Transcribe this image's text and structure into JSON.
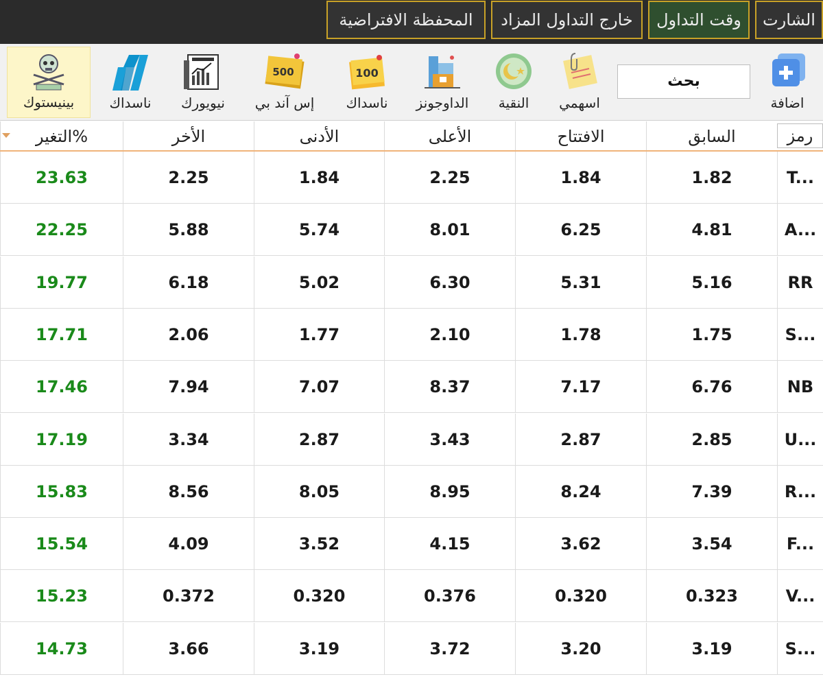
{
  "tabs": [
    {
      "label": "الشارت",
      "active": false
    },
    {
      "label": "وقت التداول",
      "active": true
    },
    {
      "label": "خارج التداول المزاد",
      "active": false
    },
    {
      "label": "المحفظة الافتراضية",
      "active": false
    }
  ],
  "toolbar": {
    "add_label": "اضافة",
    "search_text": "بحث",
    "myshares_label": "اسهمي",
    "purity_label": "النقية",
    "dowjones_label": "الداوجونز",
    "nasdaq100_label": "ناسداك",
    "nasdaq100_badge": "100",
    "sp500_label": "إس آند بي",
    "sp500_badge": "500",
    "newyork_label": "نيويورك",
    "nasdaq_label": "ناسداك",
    "binance_label": "بينيستوك"
  },
  "table": {
    "headers": {
      "symbol": "رمز",
      "prev": "السابق",
      "open": "الافتتاح",
      "high": "الأعلى",
      "low": "الأدنى",
      "last": "الأخر",
      "change": "التغير%"
    },
    "rows": [
      {
        "symbol": "T...",
        "prev": "1.82",
        "open": "1.84",
        "high": "2.25",
        "low": "1.84",
        "last": "2.25",
        "change": "23.63"
      },
      {
        "symbol": "A...",
        "prev": "4.81",
        "open": "6.25",
        "high": "8.01",
        "low": "5.74",
        "last": "5.88",
        "change": "22.25"
      },
      {
        "symbol": "RR",
        "prev": "5.16",
        "open": "5.31",
        "high": "6.30",
        "low": "5.02",
        "last": "6.18",
        "change": "19.77"
      },
      {
        "symbol": "S...",
        "prev": "1.75",
        "open": "1.78",
        "high": "2.10",
        "low": "1.77",
        "last": "2.06",
        "change": "17.71"
      },
      {
        "symbol": "NB",
        "prev": "6.76",
        "open": "7.17",
        "high": "8.37",
        "low": "7.07",
        "last": "7.94",
        "change": "17.46"
      },
      {
        "symbol": "U...",
        "prev": "2.85",
        "open": "2.87",
        "high": "3.43",
        "low": "2.87",
        "last": "3.34",
        "change": "17.19"
      },
      {
        "symbol": "R...",
        "prev": "7.39",
        "open": "8.24",
        "high": "8.95",
        "low": "8.05",
        "last": "8.56",
        "change": "15.83"
      },
      {
        "symbol": "F...",
        "prev": "3.54",
        "open": "3.62",
        "high": "4.15",
        "low": "3.52",
        "last": "4.09",
        "change": "15.54"
      },
      {
        "symbol": "V...",
        "prev": "0.323",
        "open": "0.320",
        "high": "0.376",
        "low": "0.320",
        "last": "0.372",
        "change": "15.23"
      },
      {
        "symbol": "S...",
        "prev": "3.19",
        "open": "3.20",
        "high": "3.72",
        "low": "3.19",
        "last": "3.66",
        "change": "14.73"
      }
    ]
  },
  "colors": {
    "topbar_bg": "#2b2b2b",
    "tab_border": "#c9a227",
    "active_tab_bg": "#2f4f2f",
    "change_positive": "#1a8a1a",
    "header_underline": "#f0b37a"
  }
}
